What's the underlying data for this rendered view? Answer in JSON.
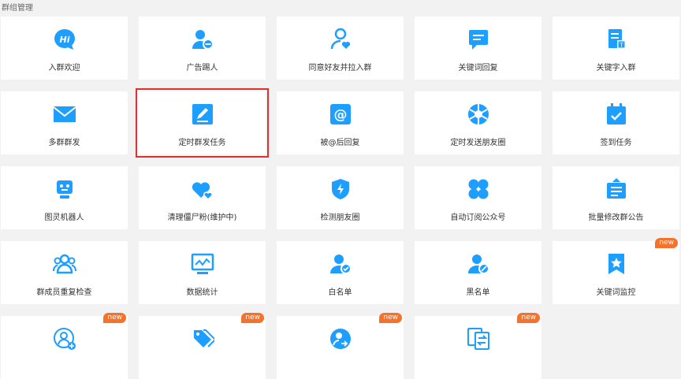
{
  "section_title": "群组管理",
  "accent": "#1e9fff",
  "badge_color": "#f4722b",
  "cards": [
    {
      "label": "入群欢迎",
      "icon": "hi-bubble-icon"
    },
    {
      "label": "广告踢人",
      "icon": "user-remove-icon"
    },
    {
      "label": "同意好友并拉入群",
      "icon": "user-heart-icon"
    },
    {
      "label": "关键词回复",
      "icon": "message-icon"
    },
    {
      "label": "关键字入群",
      "icon": "document-tag-icon"
    },
    {
      "label": "多群群发",
      "icon": "envelope-icon"
    },
    {
      "label": "定时群发任务",
      "icon": "edit-icon",
      "selected": true
    },
    {
      "label": "被@后回复",
      "icon": "at-icon"
    },
    {
      "label": "定时发送朋友圈",
      "icon": "aperture-icon"
    },
    {
      "label": "签到任务",
      "icon": "calendar-check-icon"
    },
    {
      "label": "图灵机器人",
      "icon": "robot-icon"
    },
    {
      "label": "清理僵尸粉(维护中)",
      "icon": "hearts-icon"
    },
    {
      "label": "检测朋友圈",
      "icon": "shield-bolt-icon"
    },
    {
      "label": "自动订阅公众号",
      "icon": "clover-icon"
    },
    {
      "label": "批量修改群公告",
      "icon": "notice-board-icon"
    },
    {
      "label": "群成员重复检查",
      "icon": "group-icon"
    },
    {
      "label": "数据统计",
      "icon": "monitor-chart-icon"
    },
    {
      "label": "白名单",
      "icon": "user-check-icon"
    },
    {
      "label": "黑名单",
      "icon": "user-blocked-icon"
    },
    {
      "label": "关键词监控",
      "icon": "bookmark-star-icon",
      "badge": "new"
    },
    {
      "label": "",
      "icon": "user-add-circle-icon",
      "badge": "new"
    },
    {
      "label": "",
      "icon": "tags-icon",
      "badge": "new"
    },
    {
      "label": "",
      "icon": "user-share-icon",
      "badge": "new"
    },
    {
      "label": "",
      "icon": "copy-transfer-icon",
      "badge": "new"
    }
  ]
}
